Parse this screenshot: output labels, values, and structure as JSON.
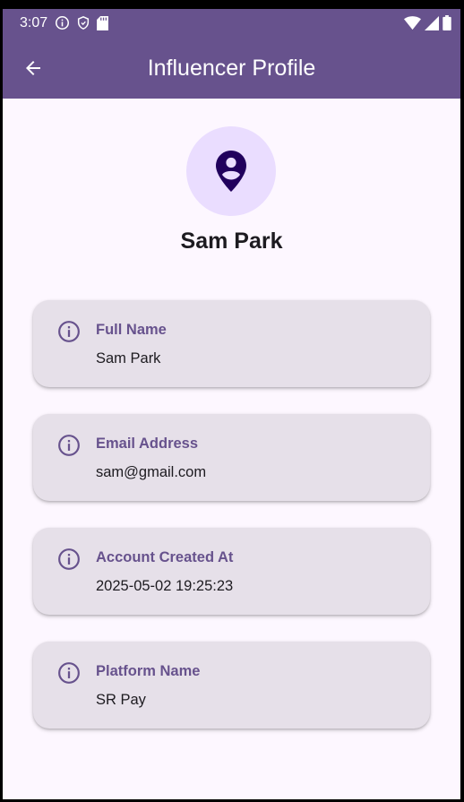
{
  "status_bar": {
    "time": "3:07",
    "icons_left": [
      "info-icon",
      "shield-icon",
      "sd-card-icon"
    ],
    "icons_right": [
      "wifi-icon",
      "signal-icon",
      "battery-icon"
    ]
  },
  "app_bar": {
    "title": "Influencer Profile",
    "back_icon": "arrow-back-icon",
    "color": "#67528d"
  },
  "profile": {
    "avatar_icon": "person-pin-icon",
    "name": "Sam Park"
  },
  "cards": [
    {
      "label": "Full Name",
      "value": "Sam Park"
    },
    {
      "label": "Email Address",
      "value": "sam@gmail.com"
    },
    {
      "label": "Account Created At",
      "value": "2025-05-02 19:25:23"
    },
    {
      "label": "Platform Name",
      "value": "SR Pay"
    }
  ],
  "colors": {
    "primary": "#67528d",
    "background": "#fdf7ff",
    "card": "#e6e0e9",
    "avatar_bg": "#eaddff",
    "avatar_icon": "#21005d"
  }
}
